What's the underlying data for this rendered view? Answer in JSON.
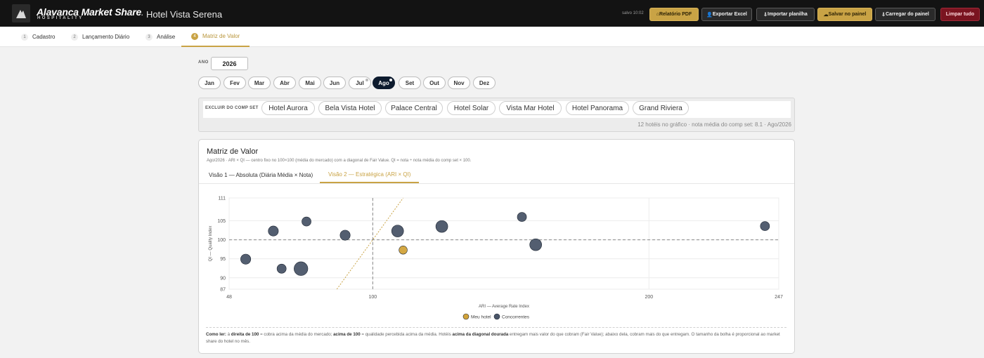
{
  "app": {
    "brand": "Alavanca Market Share",
    "brand_sub": "HOSPITALITY",
    "hotel": "· Hotel Vista Serena",
    "saved": "salvo 10:02"
  },
  "toolbar": {
    "pdf": "Relatório PDF",
    "excel": "Exportar Excel",
    "import": "Importar planilha",
    "save": "Salvar no painel",
    "load": "Carregar do painel",
    "clear": "Limpar tudo",
    "colors": {
      "gold": "#c9a345",
      "dark": "#2a2a2a",
      "danger": "#7a1420"
    }
  },
  "steps": [
    {
      "num": "1",
      "label": "Cadastro"
    },
    {
      "num": "2",
      "label": "Lançamento Diário"
    },
    {
      "num": "3",
      "label": "Análise"
    },
    {
      "num": "4",
      "label": "Matriz de Valor",
      "active": true
    }
  ],
  "year": {
    "label": "ANO",
    "value": "2026"
  },
  "months": [
    {
      "label": "Jan"
    },
    {
      "label": "Fev"
    },
    {
      "label": "Mar"
    },
    {
      "label": "Abr"
    },
    {
      "label": "Mai"
    },
    {
      "label": "Jun"
    },
    {
      "label": "Jul",
      "has_data": true
    },
    {
      "label": "Ago",
      "active": true,
      "has_data": true
    },
    {
      "label": "Set"
    },
    {
      "label": "Out"
    },
    {
      "label": "Nov"
    },
    {
      "label": "Dez"
    }
  ],
  "compset": {
    "label": "EXCLUIR DO COMP SET",
    "hotels": [
      "Hotel Aurora",
      "Bela Vista Hotel",
      "Palace Central",
      "Hotel Solar",
      "Vista Mar Hotel",
      "Hotel Panorama",
      "Grand Riviera"
    ],
    "meta": "12 hotéis no gráfico · nota média do comp set: 8.1 · Ago/2026"
  },
  "matrix": {
    "title": "Matriz de Valor",
    "subtitle": "Ago/2026 · ARI × QI — centro fixo no 100×100 (média do mercado) com a diagonal de Fair Value. QI = nota ÷ nota média do comp set × 100.",
    "tabs": [
      {
        "label": "Visão 1 — Absoluta (Diária Média × Nota)"
      },
      {
        "label": "Visão 2 — Estratégica (ARI × QI)",
        "active": true
      }
    ],
    "footnote": {
      "lead": "Como ler:",
      "t1": " à ",
      "b1": "direita de 100",
      "t2": " = cobra acima da média do mercado; ",
      "b2": "acima de 100",
      "t3": " = qualidade percebida acima da média. Hotéis ",
      "b3": "acima da diagonal dourada",
      "t4": " entregam mais valor do que cobram (Fair Value); abaixo dela, cobram mais do que entregam. O tamanho da bolha é proporcional ao market share do hotel no mês."
    }
  },
  "chart_data": {
    "type": "scatter",
    "xlabel": "ARI — Average Rate Index",
    "ylabel": "QI — Quality Index",
    "xlim": [
      48,
      247
    ],
    "ylim": [
      87,
      111
    ],
    "x_ticks": [
      48,
      100,
      200,
      247
    ],
    "y_ticks": [
      87,
      90,
      95,
      100,
      105,
      111
    ],
    "reference_lines": {
      "x": 100,
      "y": 100,
      "fair_value_diagonal": true
    },
    "grid": true,
    "legend": {
      "position": "bottom-center",
      "entries": [
        "Meu hotel",
        "Concorrentes"
      ]
    },
    "colors": {
      "own": "#d2a33a",
      "competitors": "#4a5568",
      "diagonal": "#c9a345"
    },
    "series": [
      {
        "name": "Meu hotel",
        "points": [
          {
            "x": 111,
            "y": 97.3,
            "share": 3
          }
        ]
      },
      {
        "name": "Concorrentes",
        "points": [
          {
            "x": 54,
            "y": 94.9,
            "share": 4
          },
          {
            "x": 64,
            "y": 102.3,
            "share": 4
          },
          {
            "x": 67,
            "y": 92.4,
            "share": 3.5
          },
          {
            "x": 74,
            "y": 92.4,
            "share": 6
          },
          {
            "x": 76,
            "y": 104.8,
            "share": 3.5
          },
          {
            "x": 90,
            "y": 101.2,
            "share": 4
          },
          {
            "x": 109,
            "y": 102.3,
            "share": 5
          },
          {
            "x": 125,
            "y": 103.5,
            "share": 5
          },
          {
            "x": 154,
            "y": 106.0,
            "share": 3.5
          },
          {
            "x": 159,
            "y": 98.7,
            "share": 5
          },
          {
            "x": 242,
            "y": 103.6,
            "share": 3.5
          }
        ]
      }
    ]
  }
}
